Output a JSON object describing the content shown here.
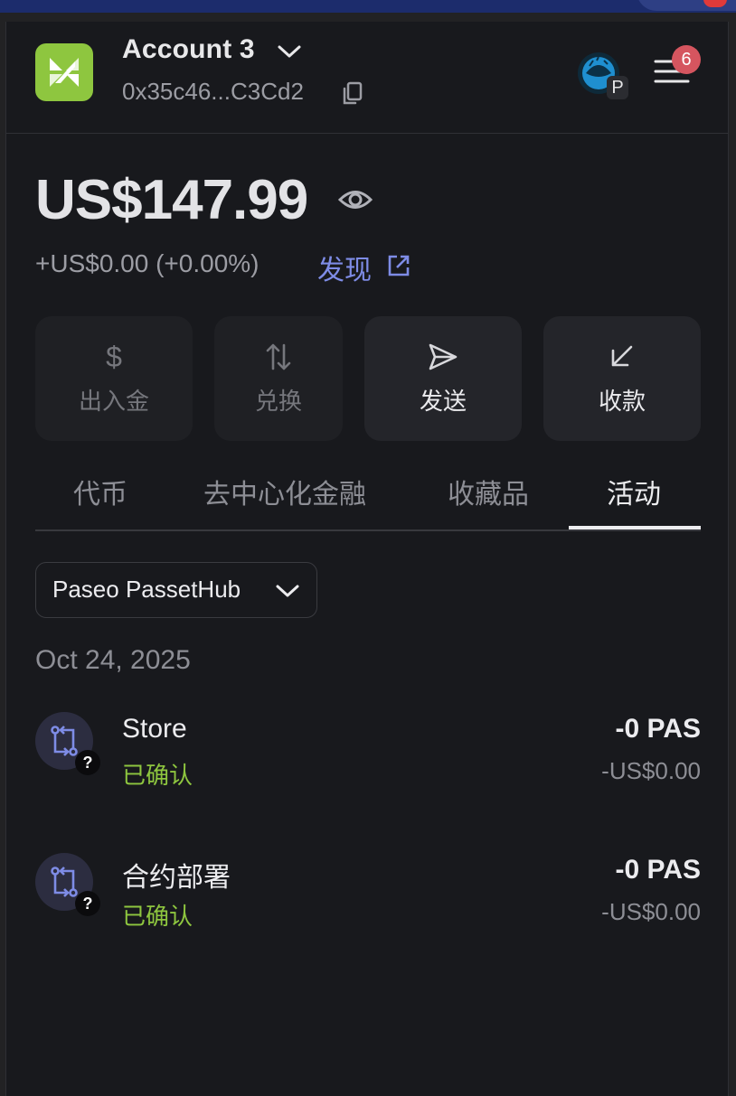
{
  "header": {
    "account_name": "Account 3",
    "address": "0x35c46...C3Cd2",
    "network_badge": "P",
    "notification_count": "6"
  },
  "balance": {
    "total": "US$147.99",
    "change": "+US$0.00 (+0.00%)",
    "discover_label": "发现"
  },
  "actions": [
    {
      "label": "出入金",
      "icon": "dollar-icon",
      "enabled": false
    },
    {
      "label": "兑换",
      "icon": "swap-icon",
      "enabled": false
    },
    {
      "label": "发送",
      "icon": "send-icon",
      "enabled": true
    },
    {
      "label": "收款",
      "icon": "receive-icon",
      "enabled": true
    }
  ],
  "tabs": [
    {
      "label": "代币",
      "active": false
    },
    {
      "label": "去中心化金融",
      "active": false
    },
    {
      "label": "收藏品",
      "active": false
    },
    {
      "label": "活动",
      "active": true
    }
  ],
  "filter": {
    "network": "Paseo PassetHub"
  },
  "activity": {
    "date": "Oct 24, 2025",
    "items": [
      {
        "title": "Store",
        "status": "已确认",
        "amount": "-0 PAS",
        "fiat": "-US$0.00",
        "badge": "?"
      },
      {
        "title": "合约部署",
        "status": "已确认",
        "amount": "-0 PAS",
        "fiat": "-US$0.00",
        "badge": "?"
      }
    ]
  },
  "colors": {
    "background": "#18191d",
    "brand_green": "#8ec63f",
    "link": "#7e8ce6",
    "badge_red": "#d5555f"
  }
}
